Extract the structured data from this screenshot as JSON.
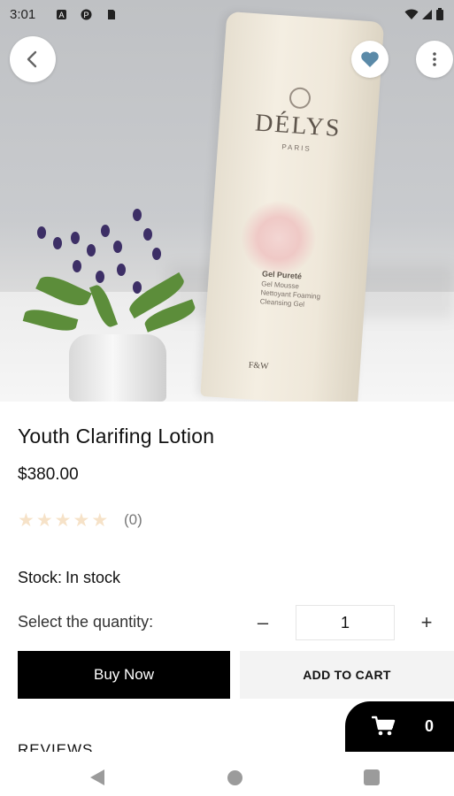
{
  "status_bar": {
    "time": "3:01",
    "left_icons": [
      "a-icon",
      "p-icon",
      "sim-card-icon"
    ],
    "right_icons": [
      "wifi-icon",
      "signal-icon",
      "battery-icon"
    ]
  },
  "hero": {
    "brand": "DÉLYS",
    "city": "PARIS",
    "product_line_1": "Gel Pureté",
    "product_line_2": "Gel Mousse Nettoyant Foaming Cleansing Gel",
    "maker_mark": "F&W"
  },
  "product": {
    "title": "Youth Clarifing Lotion",
    "price": "$380.00",
    "rating_count": "(0)",
    "stock_label": "Stock:",
    "stock_value": "In stock",
    "quantity_label": "Select the quantity:",
    "quantity_value": "1",
    "minus": "–",
    "plus": "+"
  },
  "actions": {
    "buy_now": "Buy Now",
    "add_to_cart": "ADD TO CART"
  },
  "reviews_heading": "REVIEWS",
  "cart": {
    "count": "0"
  },
  "colors": {
    "primary": "#000000",
    "star_empty": "#f6e2c8",
    "secondary_button": "#f3f3f3",
    "fav_icon": "#5b8aa8"
  }
}
